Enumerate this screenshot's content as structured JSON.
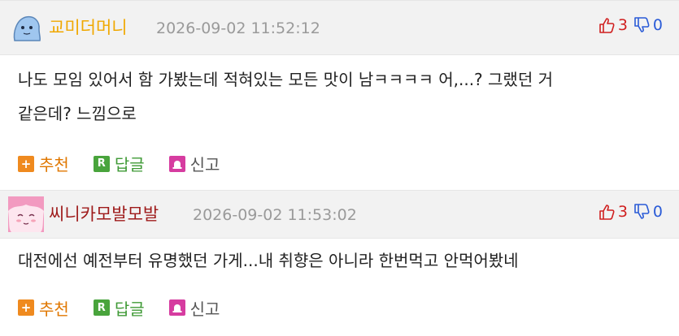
{
  "comments": [
    {
      "nickname": "교미더머니",
      "nickname_color": "#f0a800",
      "timestamp": "2026-09-02 11:52:12",
      "upvotes": "3",
      "downvotes": "0",
      "text_line1": "나도 모임 있어서 함 가봤는데 적혀있는 모든 맛이 남ㅋㅋㅋㅋ 어,...? 그랬던 거",
      "text_line2": "같은데? 느낌으로",
      "actions": {
        "recommend": "추천",
        "reply": "답글",
        "report": "신고"
      }
    },
    {
      "nickname": "씨니카모발모발",
      "nickname_color": "#9e1a1a",
      "timestamp": "2026-09-02 11:53:02",
      "upvotes": "3",
      "downvotes": "0",
      "text_line1": "대전에선 예전부터 유명했던 가게...내 취향은 아니라 한번먹고 안먹어봤네",
      "actions": {
        "recommend": "추천",
        "reply": "답글",
        "report": "신고"
      }
    }
  ]
}
